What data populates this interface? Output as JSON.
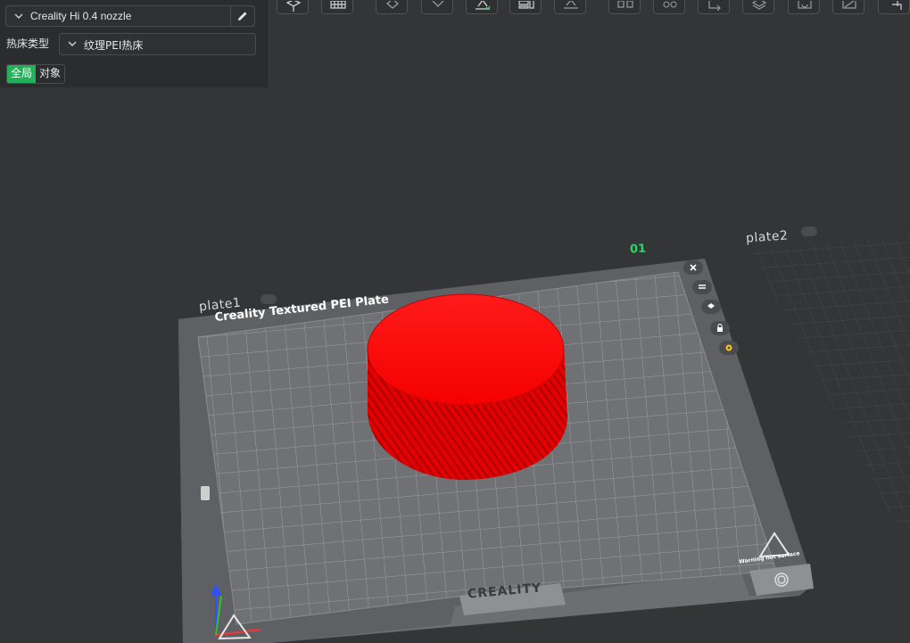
{
  "printer": {
    "name": "Creality Hi 0.4 nozzle"
  },
  "bed": {
    "label": "热床类型",
    "value": "纹理PEI热床"
  },
  "scope_toggle": {
    "global": "全局",
    "object": "对象"
  },
  "scene": {
    "plate1_label": "plate1",
    "plate2_label": "plate2",
    "plate_number": "01",
    "bed_title": "Creality Textured PEI Plate",
    "brand": "CREALITY",
    "warning": "Warning hot surface",
    "model_color": "#ff0000",
    "selected_color": "#2fd46a"
  }
}
